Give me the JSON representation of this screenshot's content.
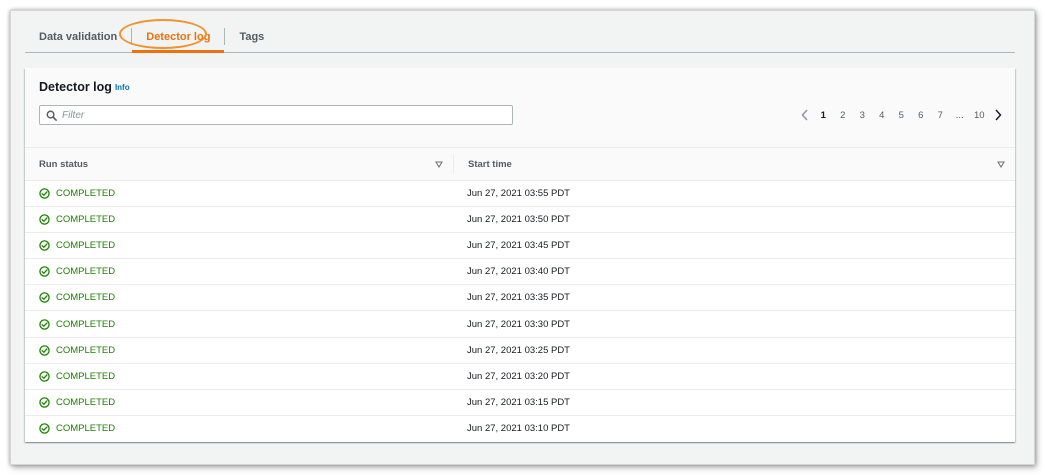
{
  "tabs": [
    {
      "label": "Data validation",
      "active": false
    },
    {
      "label": "Detector log",
      "active": true
    },
    {
      "label": "Tags",
      "active": false
    }
  ],
  "panel": {
    "title": "Detector log",
    "info_label": "Info",
    "filter_placeholder": "Filter",
    "filter_value": ""
  },
  "pagination": {
    "pages": [
      "1",
      "2",
      "3",
      "4",
      "5",
      "6",
      "7"
    ],
    "ellipsis": "...",
    "last_page": "10",
    "current": "1"
  },
  "table": {
    "columns": [
      "Run status",
      "Start time"
    ],
    "rows": [
      {
        "status": "COMPLETED",
        "start_time": "Jun 27, 2021 03:55 PDT"
      },
      {
        "status": "COMPLETED",
        "start_time": "Jun 27, 2021 03:50 PDT"
      },
      {
        "status": "COMPLETED",
        "start_time": "Jun 27, 2021 03:45 PDT"
      },
      {
        "status": "COMPLETED",
        "start_time": "Jun 27, 2021 03:40 PDT"
      },
      {
        "status": "COMPLETED",
        "start_time": "Jun 27, 2021 03:35 PDT"
      },
      {
        "status": "COMPLETED",
        "start_time": "Jun 27, 2021 03:30 PDT"
      },
      {
        "status": "COMPLETED",
        "start_time": "Jun 27, 2021 03:25 PDT"
      },
      {
        "status": "COMPLETED",
        "start_time": "Jun 27, 2021 03:20 PDT"
      },
      {
        "status": "COMPLETED",
        "start_time": "Jun 27, 2021 03:15 PDT"
      },
      {
        "status": "COMPLETED",
        "start_time": "Jun 27, 2021 03:10 PDT"
      }
    ]
  },
  "colors": {
    "accent": "#ec7211",
    "success": "#1d8102",
    "link": "#0073bb"
  },
  "icons": {
    "status": "check-circle-icon",
    "filter": "search-icon",
    "sort": "caret-down-outline-icon",
    "prev": "chevron-left-icon",
    "next": "chevron-right-icon"
  }
}
